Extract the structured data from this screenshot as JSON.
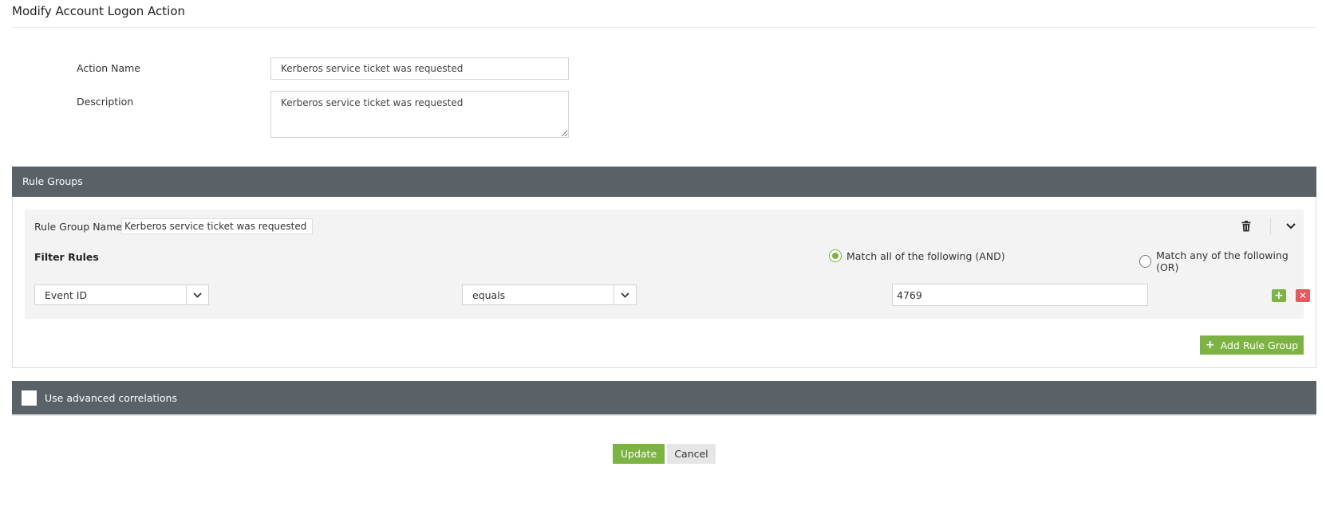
{
  "page": {
    "title": "Modify Account Logon Action"
  },
  "form": {
    "action_name_label": "Action Name",
    "action_name_value": "Kerberos service ticket was requested",
    "description_label": "Description",
    "description_value": "Kerberos service ticket was requested"
  },
  "rule_groups": {
    "header": "Rule Groups",
    "group_name_label": "Rule Group Name :",
    "group_name_value": "Kerberos service ticket was requested",
    "filter_rules_label": "Filter Rules",
    "match_all_label": "Match all of the following (AND)",
    "match_any_label": "Match any of the following (OR)",
    "match_selected": "all",
    "rule": {
      "field": "Event ID",
      "operator": "equals",
      "value": "4769"
    },
    "add_rule_group_label": "Add Rule Group",
    "icons": {
      "delete": "trash-icon",
      "collapse": "chevron-down-icon",
      "add_rule": "plus-icon",
      "remove_rule": "close-icon"
    }
  },
  "advanced": {
    "label": "Use advanced correlations",
    "checked": false
  },
  "footer": {
    "update_label": "Update",
    "cancel_label": "Cancel"
  },
  "colors": {
    "accent_green": "#7cb342",
    "danger_red": "#e25b5b",
    "section_header": "#5a6268"
  }
}
